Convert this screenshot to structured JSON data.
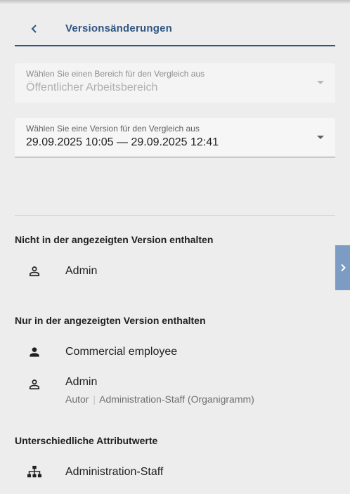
{
  "header": {
    "back_icon": "chevron-left-icon",
    "title": "Versionsänderungen"
  },
  "area_select": {
    "label": "Wählen Sie einen Bereich für den Vergleich aus",
    "value": "Öffentlicher Arbeitsbereich",
    "disabled": true
  },
  "version_select": {
    "label": "Wählen Sie eine Version für den Vergleich aus",
    "value": "29.09.2025 10:05 — 29.09.2025 12:41"
  },
  "sections": {
    "not_in_version": {
      "title": "Nicht in der angezeigten Version enthalten",
      "items": [
        {
          "icon": "person-outline-icon",
          "title": "Admin"
        }
      ]
    },
    "only_in_version": {
      "title": "Nur in der angezeigten Version enthalten",
      "items": [
        {
          "icon": "person-filled-icon",
          "title": "Commercial employee"
        },
        {
          "icon": "person-outline-icon",
          "title": "Admin",
          "role": "Autor",
          "separator": "|",
          "context": "Administration-Staff (Organigramm)"
        }
      ]
    },
    "different_attributes": {
      "title": "Unterschiedliche Attributwerte",
      "items": [
        {
          "icon": "org-chart-icon",
          "title": "Administration-Staff"
        }
      ]
    }
  },
  "side_panel_toggle": {
    "icon": "chevron-right-icon"
  },
  "colors": {
    "accent": "#2f5584",
    "background": "#ededed",
    "side_tab": "#7d9cc4"
  }
}
